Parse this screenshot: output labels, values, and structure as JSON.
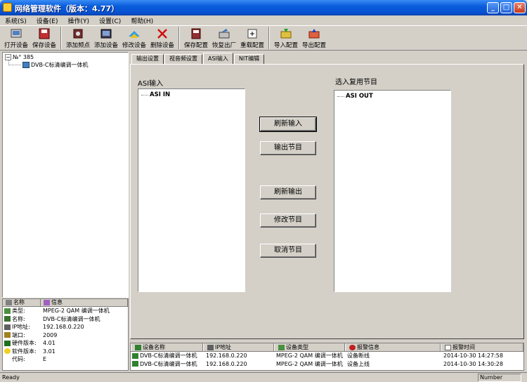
{
  "window": {
    "title": "网络管理软件（版本：4.77）"
  },
  "menu": [
    "系统(S)",
    "设备(E)",
    "操作(Y)",
    "设置(C)",
    "帮助(H)"
  ],
  "toolbar": {
    "open": "打开设备",
    "save": "保存设备",
    "add_channel": "添加频点",
    "add_device": "添加设备",
    "modify_device": "修改设备",
    "delete_device": "删除设备",
    "save_config": "保存配置",
    "restore_factory": "恢复出厂",
    "reload_config": "重载配置",
    "import_config": "导入配置",
    "export_config": "导出配置"
  },
  "tree": {
    "root": "№° 385",
    "child": "DVB-C标清编调一体机"
  },
  "info": {
    "col_name": "名称",
    "col_info": "信息",
    "rows": [
      {
        "k": "类型:",
        "v": "MPEG-2 QAM 编调一体机"
      },
      {
        "k": "名称:",
        "v": "DVB-C标清编调一体机"
      },
      {
        "k": "IP地址:",
        "v": "192.168.0.220"
      },
      {
        "k": "端口:",
        "v": "2009"
      },
      {
        "k": "硬件版本:",
        "v": "4.01"
      },
      {
        "k": "软件版本:",
        "v": "3.01"
      },
      {
        "k": "代码:",
        "v": "E"
      }
    ]
  },
  "tabs": [
    "输出设置",
    "视音频设置",
    "ASI输入",
    "NIT编辑"
  ],
  "panel": {
    "asi_label": "ASI输入",
    "mux_label": "选入复用节目",
    "asi_node": "ASI IN",
    "mux_node": "ASI OUT",
    "btn_refresh_in": "刷新输入",
    "btn_output": "输出节目",
    "btn_refresh_out": "刷新输出",
    "btn_modify": "修改节目",
    "btn_cancel": "取消节目"
  },
  "events": {
    "headers": [
      "设备名称",
      "IP地址",
      "设备类型",
      "报警信息",
      "报警时间"
    ],
    "rows": [
      [
        "DVB-C标清编调一体机",
        "192.168.0.220",
        "MPEG-2 QAM 编调一体机",
        "设备断线",
        "2014-10-30 14:27:58"
      ],
      [
        "DVB-C标清编调一体机",
        "192.168.0.220",
        "MPEG-2 QAM 编调一体机",
        "设备上线",
        "2014-10-30 14:30:28"
      ]
    ]
  },
  "status": {
    "left": "Ready",
    "right": "Number"
  }
}
